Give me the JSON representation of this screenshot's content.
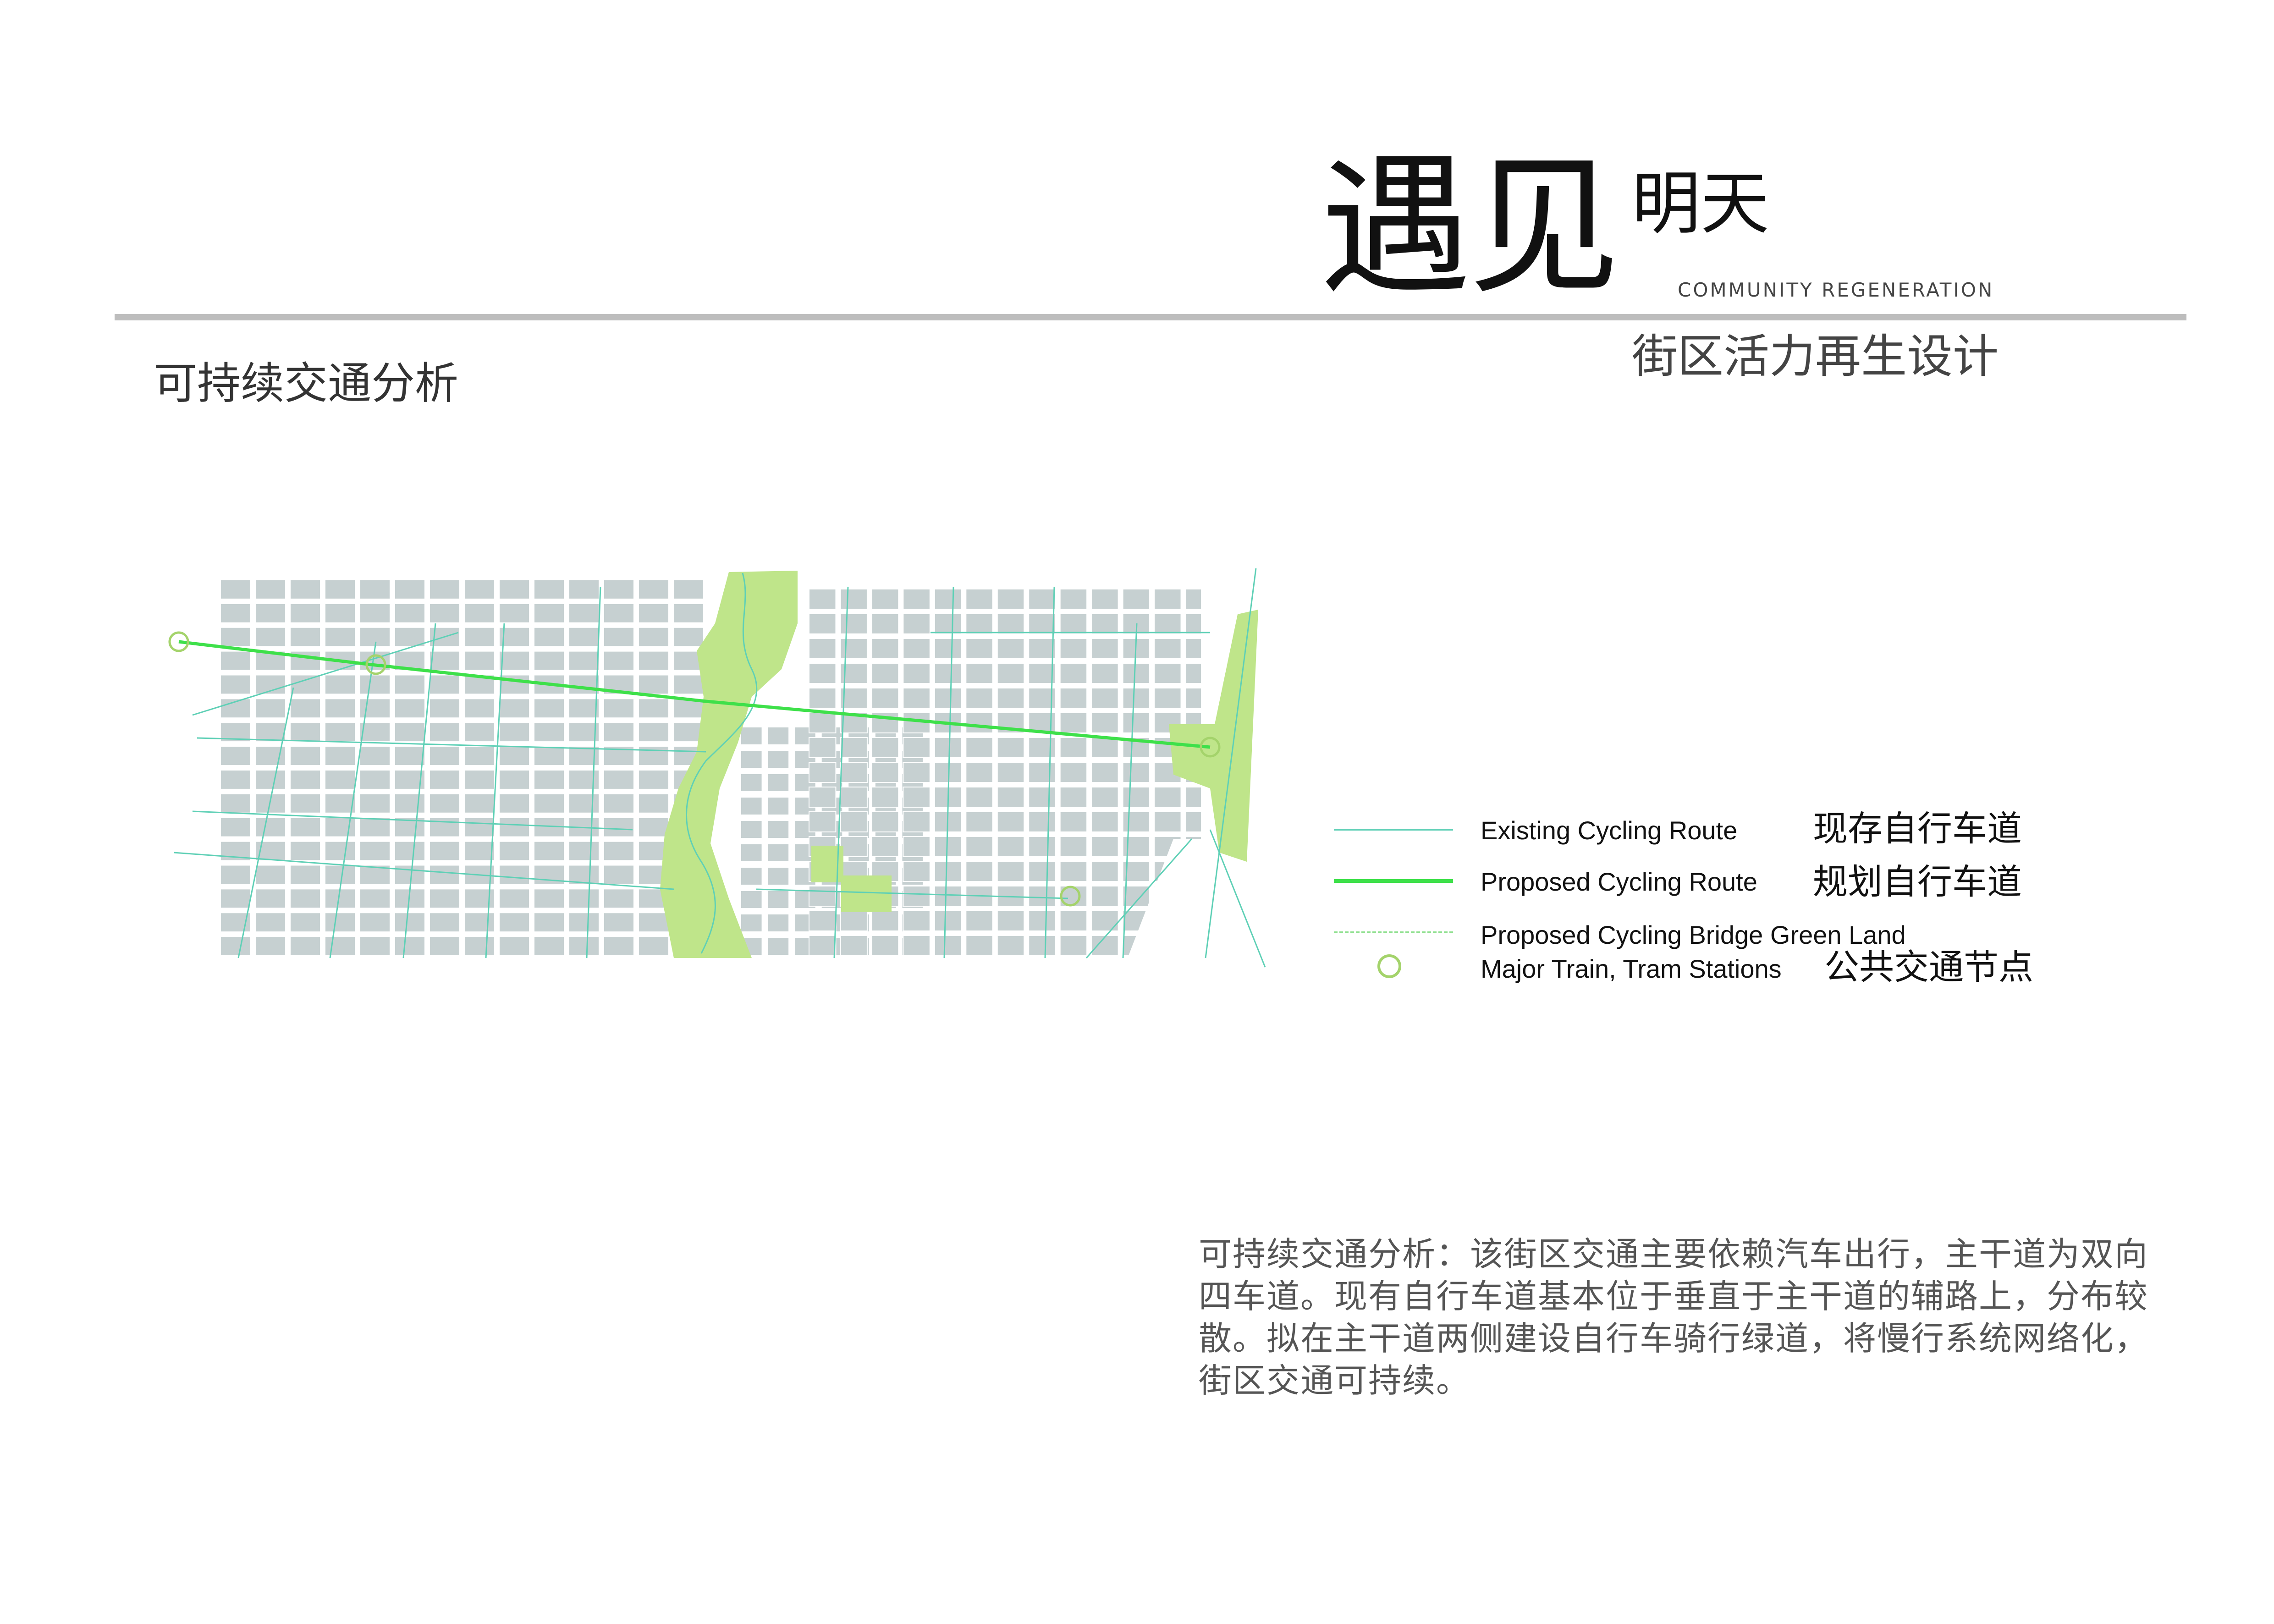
{
  "header": {
    "title_large": "遇见",
    "title_small": "明天",
    "subtitle_en": "COMMUNITY REGENERATION",
    "subtitle_zh": "街区活力再生设计"
  },
  "section_title": "可持续交通分析",
  "legend": [
    {
      "en": "Existing Cycling Route",
      "zh": "现存自行车道",
      "color": "#5fd0b6",
      "style": "thin-line"
    },
    {
      "en": "Proposed Cycling Route",
      "zh": "规划自行车道",
      "color": "#3ee04a",
      "style": "bold-line"
    },
    {
      "en": "Proposed Cycling Bridge Green Land",
      "zh": "",
      "color": "#8fe08f",
      "style": "dashed-line"
    },
    {
      "en": "Major Train, Tram Stations",
      "zh": "公共交通节点",
      "color": "#a4d36b",
      "style": "ring"
    }
  ],
  "description": "可持续交通分析：该街区交通主要依赖汽车出行，主干道为双向四车道。现有自行车道基本位于垂直于主干道的辅路上，分布较散。拟在主干道两侧建设自行车骑行绿道，将慢行系统网络化，街区交通可持续。",
  "map_colors": {
    "block": "#c6d0d1",
    "green_land": "#bfe58a",
    "existing_route": "#5fd0b6",
    "proposed_route": "#3ee04a",
    "station": "#a4d36b",
    "edge": "#9fb0b2"
  }
}
